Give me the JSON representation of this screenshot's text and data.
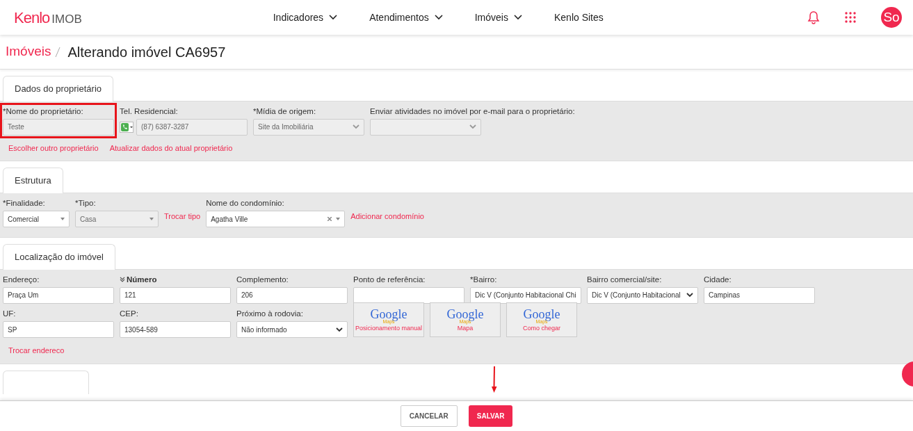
{
  "navbar": {
    "logo": {
      "brand": "Kenlo",
      "product": "IMOB"
    },
    "menu": [
      {
        "label": "Indicadores",
        "dropdown": true
      },
      {
        "label": "Atendimentos",
        "dropdown": true
      },
      {
        "label": "Imóveis",
        "dropdown": true
      },
      {
        "label": "Kenlo Sites",
        "dropdown": false
      }
    ],
    "avatar": "So"
  },
  "breadcrumb": {
    "parent": "Imóveis",
    "title": "Alterando imóvel CA6957"
  },
  "sections": [
    {
      "title": "Dados do proprietário",
      "rows": [
        [
          {
            "kind": "text",
            "label": "*Nome do proprietário:",
            "value": "Teste",
            "disabled": true,
            "highlighted": true
          },
          {
            "kind": "phone",
            "label": "Tel. Residencial:",
            "value": "(87) 6387-3287",
            "disabled": true
          },
          {
            "kind": "select",
            "label": "*Mídia de origem:",
            "value": "Site da Imobiliária",
            "disabled": true
          },
          {
            "kind": "select",
            "label": "Enviar atividades no imóvel por e-mail para o proprietário:",
            "disabled": true
          }
        ]
      ],
      "links": [
        "Escolher outro proprietário",
        "Atualizar dados do atual proprietário"
      ]
    },
    {
      "title": "Estrutura",
      "rows": [
        [
          {
            "kind": "select2",
            "label": "*Finalidade:",
            "value": "Comercial",
            "disabled": false
          },
          {
            "kind": "select2",
            "label": "*Tipo:",
            "value": "Casa",
            "disabled": true
          },
          {
            "kind": "link",
            "label": "Trocar tipo"
          },
          {
            "kind": "combo",
            "label": "Nome do condomínio:",
            "value": "Agatha Ville",
            "disabled": false
          },
          {
            "kind": "link",
            "label": "Adicionar condomínio"
          }
        ]
      ]
    },
    {
      "title": "Localização do imóvel",
      "rows": [
        [
          {
            "kind": "text",
            "label": "Endereço:",
            "value": "Praça Um",
            "disabled": false
          },
          {
            "kind": "text",
            "label": "Número",
            "value": "121",
            "disabled": false,
            "collapsible": true
          },
          {
            "kind": "text",
            "label": "Complemento:",
            "value": "206",
            "disabled": false
          },
          {
            "kind": "text",
            "label": "Ponto de referência:",
            "disabled": false
          },
          {
            "kind": "text",
            "label": "*Bairro:",
            "value": "Dic V (Conjunto Habitacional Chi",
            "disabled": false
          },
          {
            "kind": "select",
            "label": "Bairro comercial/site:",
            "value": "Dic V (Conjunto Habitacional",
            "disabled": false
          },
          {
            "kind": "text",
            "label": "Cidade:",
            "value": "Campinas",
            "disabled": false
          }
        ],
        [
          {
            "kind": "text",
            "label": "UF:",
            "value": "SP",
            "disabled": false
          },
          {
            "kind": "text",
            "label": "CEP:",
            "value": "13054-589",
            "disabled": false
          },
          {
            "kind": "select",
            "label": "Próximo à rodovia:",
            "value": "Não informado",
            "disabled": false
          }
        ]
      ],
      "maps_buttons": [
        {
          "kind": "maps",
          "logo": "Google",
          "sub": "Maps",
          "label": "Posicionamento manual"
        },
        {
          "kind": "maps",
          "logo": "Google",
          "sub": "Maps",
          "label": "Mapa"
        },
        {
          "kind": "maps",
          "logo": "Google",
          "sub": "Maps",
          "label": "Como chegar"
        }
      ],
      "links": [
        "Trocar endereco"
      ]
    }
  ],
  "footer": {
    "buttons": [
      {
        "label": "CANCELAR",
        "kind": "secondary"
      },
      {
        "label": "SALVAR",
        "kind": "primary",
        "pointed": true
      }
    ]
  }
}
